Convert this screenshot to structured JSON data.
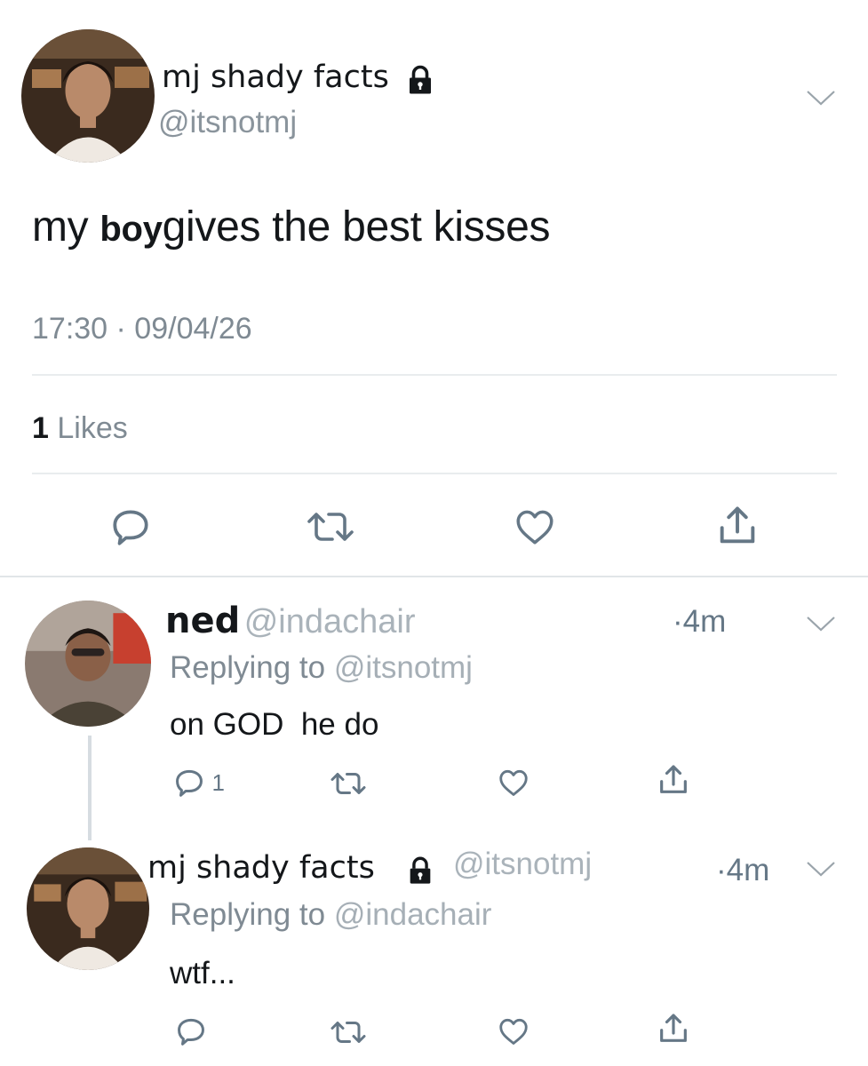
{
  "main_tweet": {
    "display_name": "mj shady facts",
    "handle": "@itsnotmj",
    "text_before": "my ",
    "text_bold": "boy",
    "text_after": "gives the best kisses",
    "timestamp": "17:30 · 09/04/26",
    "likes_count": "1",
    "likes_label": "Likes",
    "icons": [
      "reply-icon",
      "retweet-icon",
      "like-icon",
      "share-icon",
      "lock-icon",
      "chevron-down-icon"
    ]
  },
  "reply_1": {
    "display_name": "ned",
    "handle": "@indachair",
    "time": "·4m",
    "replying_prefix": "Replying to",
    "replying_handle": "@itsnotmj",
    "text": "on GOD  he do",
    "reply_count": "1"
  },
  "reply_2": {
    "display_name": "mj shady facts",
    "handle": "@itsnotmj",
    "time": "·4m",
    "replying_prefix": "Replying to",
    "replying_handle": "@indachair",
    "text": "wtf..."
  },
  "colors": {
    "text": "#14171a",
    "secondary": "#8a949c",
    "icon": "#657786",
    "divider": "#e9ecee",
    "thread_line": "#d6dce1"
  }
}
